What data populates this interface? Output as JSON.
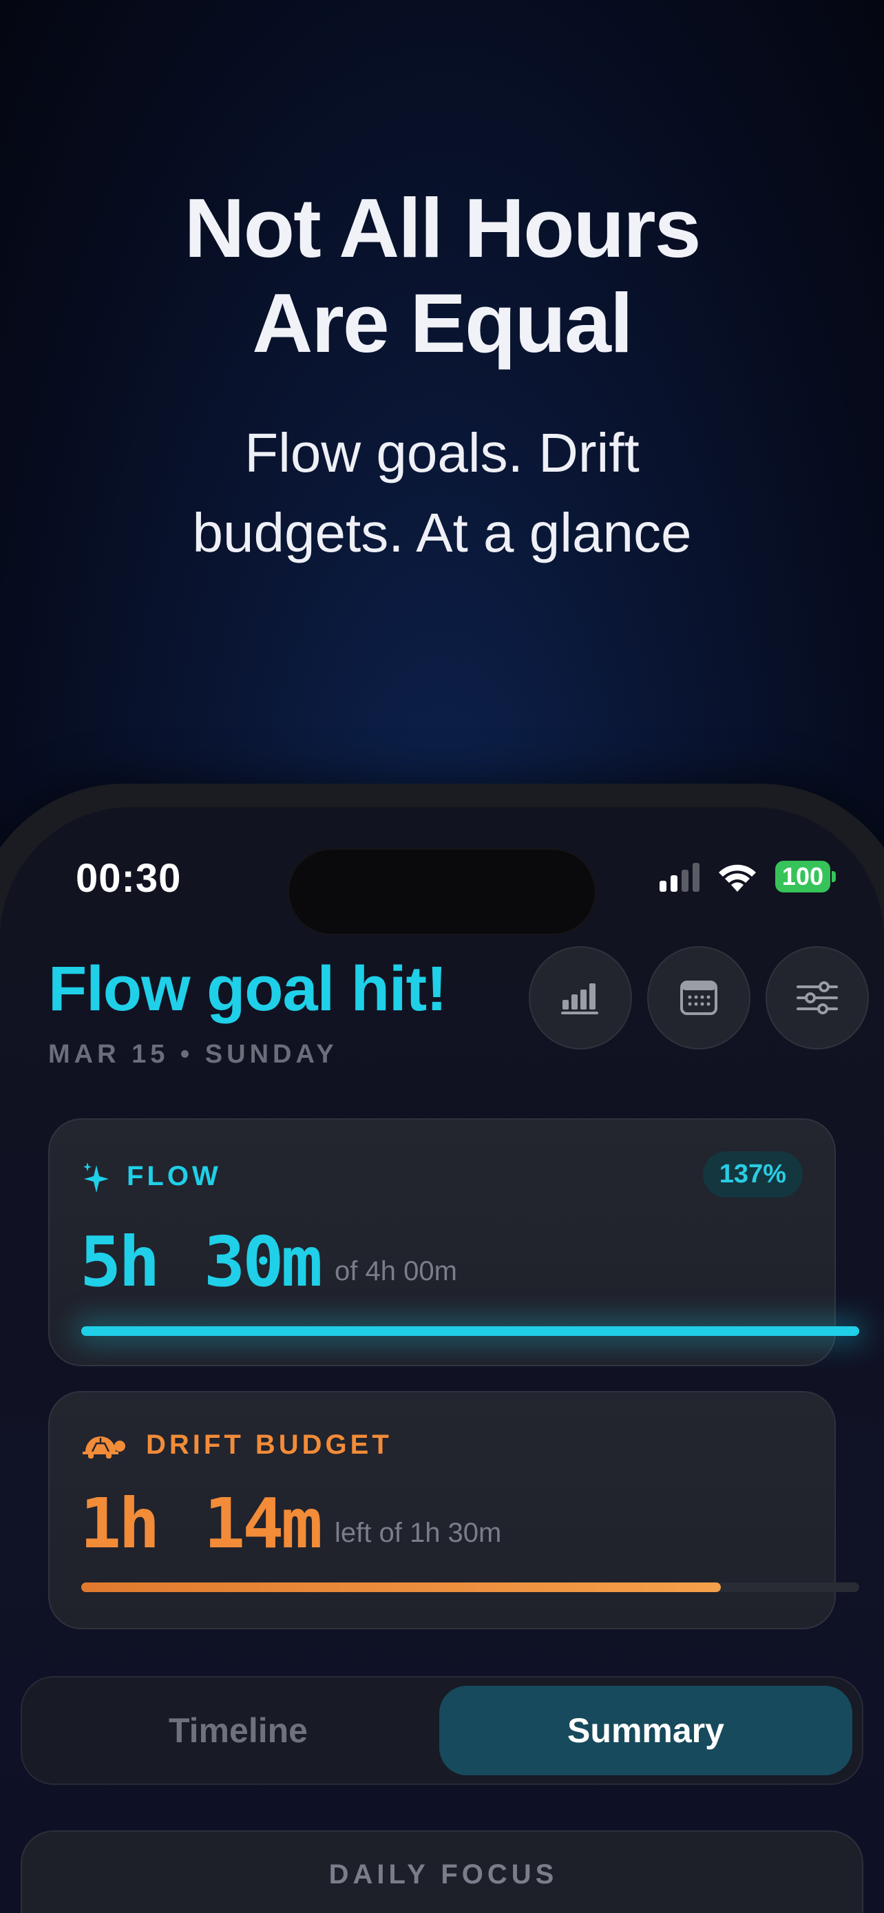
{
  "headline": {
    "line1": "Not All Hours",
    "line2": "Are Equal"
  },
  "subhead": {
    "line1": "Flow goals. Drift",
    "line2": "budgets. At a glance"
  },
  "status_bar": {
    "time": "00:30",
    "battery": "100"
  },
  "header": {
    "title": "Flow goal hit!",
    "date": "MAR 15 • SUNDAY",
    "buttons": [
      {
        "icon": "bar-chart-icon"
      },
      {
        "icon": "calendar-icon"
      },
      {
        "icon": "sliders-icon"
      }
    ]
  },
  "flow_card": {
    "label": "FLOW",
    "icon": "sparkle-icon",
    "percent": "137%",
    "hours": "5h",
    "minutes": "30m",
    "goal_text": "of 4h 00m",
    "progress": 1.0,
    "color": "#1fd0e8"
  },
  "drift_card": {
    "label": "DRIFT BUDGET",
    "icon": "turtle-icon",
    "hours": "1h",
    "minutes": "14m",
    "budget_text": "left of 1h 30m",
    "progress": 0.822,
    "color": "#f28c38"
  },
  "segmented_control": {
    "options": [
      "Timeline",
      "Summary"
    ],
    "selected": "Summary"
  },
  "daily_focus": {
    "label": "DAILY FOCUS"
  }
}
